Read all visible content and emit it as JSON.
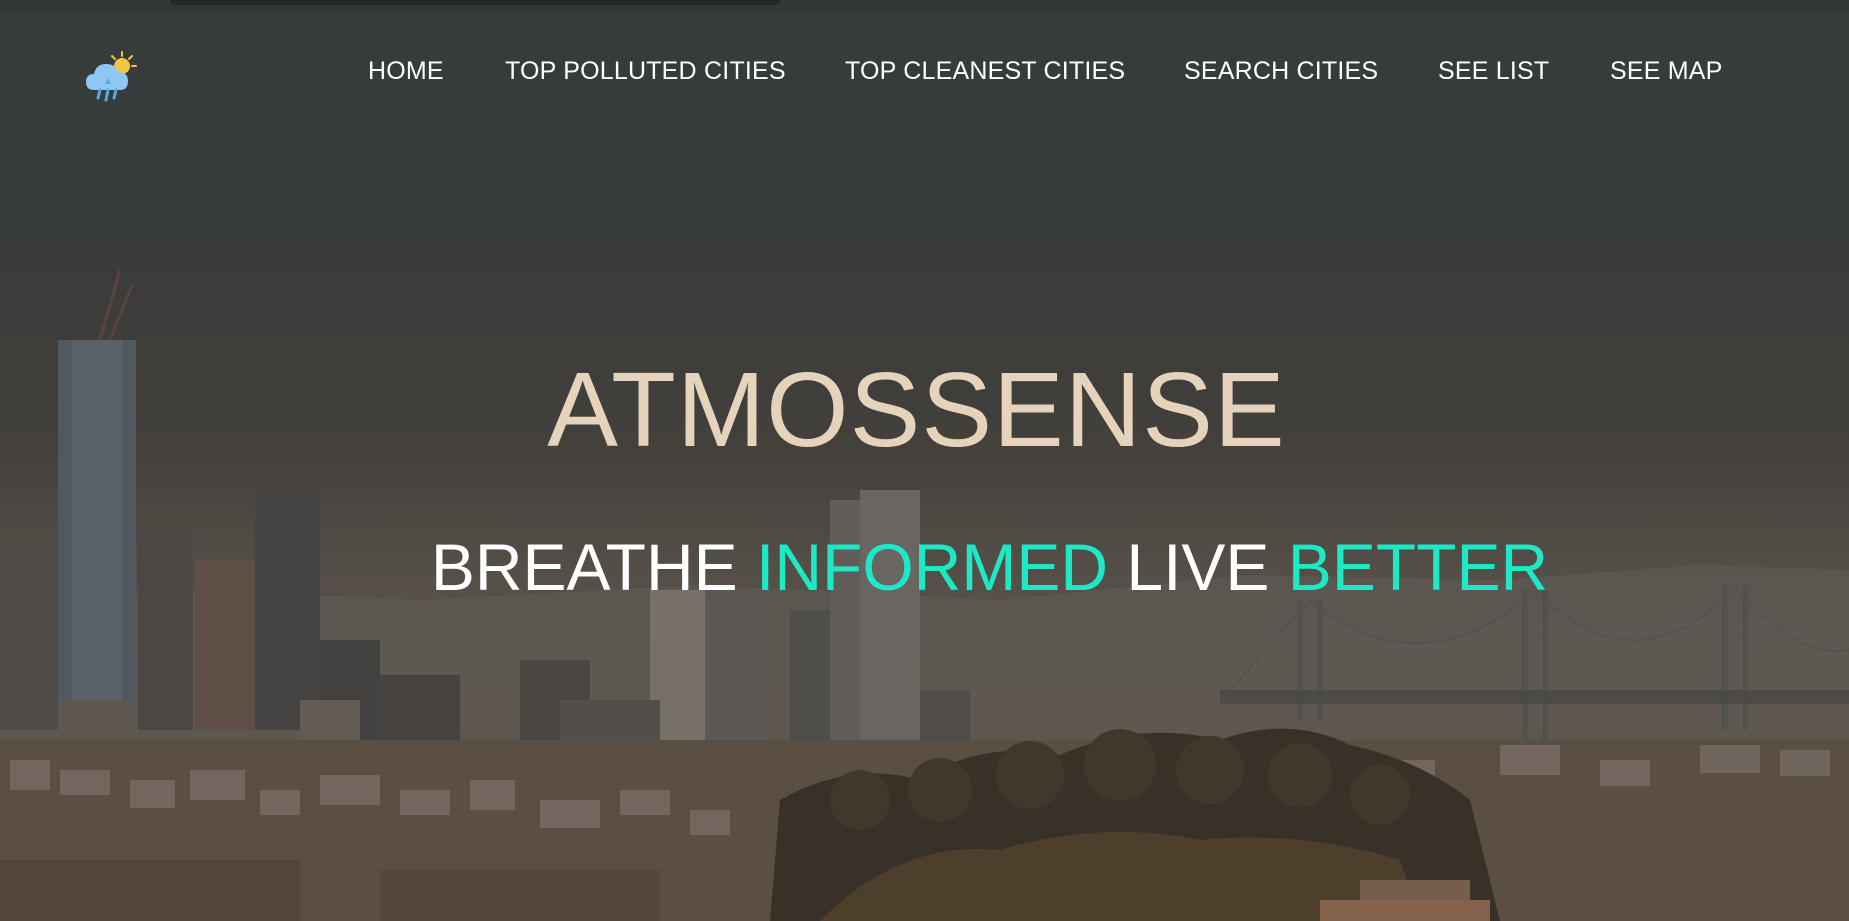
{
  "brand": {
    "logo_icon": "cloud-sun-rain-icon"
  },
  "nav": {
    "items": [
      {
        "label": "HOME"
      },
      {
        "label": "TOP POLLUTED CITIES"
      },
      {
        "label": "TOP CLEANEST CITIES"
      },
      {
        "label": "SEARCH CITIES"
      },
      {
        "label": "SEE LIST"
      },
      {
        "label": "SEE MAP"
      }
    ]
  },
  "hero": {
    "title": "ATMOSSENSE",
    "tagline": {
      "word1": "BREATHE",
      "word2": "INFORMED",
      "word3": "LIVE",
      "word4": "BETTER"
    }
  },
  "colors": {
    "title": "#e6d3bb",
    "accent": "#1de9c7",
    "nav_text": "#ffffff"
  }
}
